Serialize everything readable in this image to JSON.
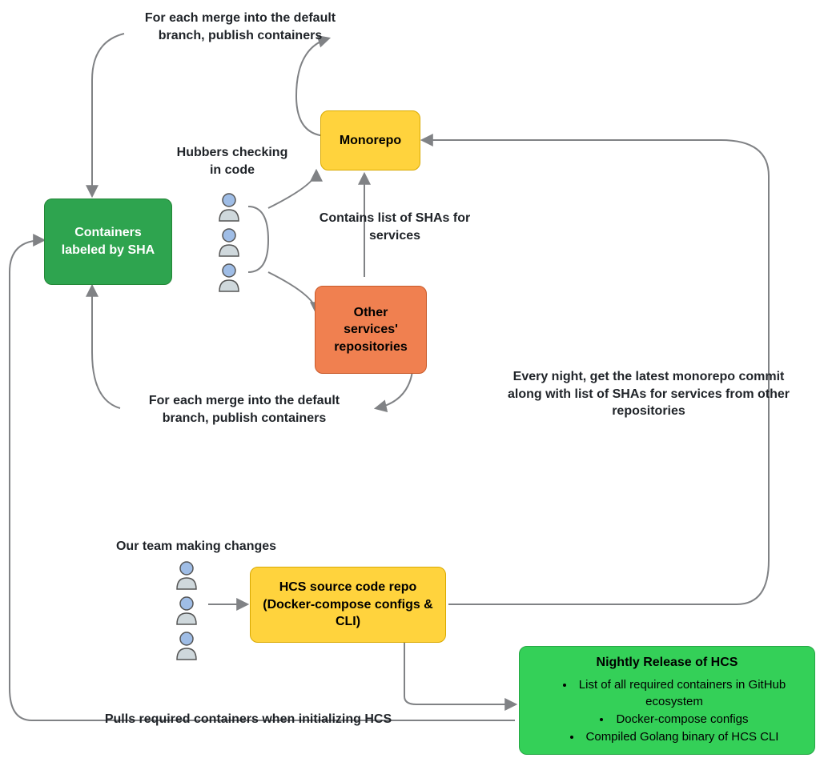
{
  "nodes": {
    "containers": "Containers labeled by SHA",
    "monorepo": "Monorepo",
    "other_repos": "Other services' repositories",
    "hcs_repo": "HCS source code repo (Docker-compose configs & CLI)"
  },
  "nightly": {
    "title": "Nightly Release of HCS",
    "items": [
      "List of all required containers in GitHub ecosystem",
      "Docker-compose configs",
      "Compiled Golang binary of HCS CLI"
    ]
  },
  "labels": {
    "merge_top": "For each merge into the default branch, publish containers",
    "hubbers": "Hubbers checking in code",
    "shas_for_services": "Contains list of SHAs for services",
    "merge_bottom": "For each merge into the default branch, publish containers",
    "every_night": "Every night, get the latest monorepo commit along with list of SHAs for services from other repositories",
    "team_changes": "Our team making changes",
    "pulls_required": "Pulls required containers when initializing HCS"
  },
  "colors": {
    "green": "#2ea44f",
    "yellow": "#ffd33d",
    "orange": "#f08050",
    "nightly": "#34d058",
    "edge": "#808285"
  }
}
